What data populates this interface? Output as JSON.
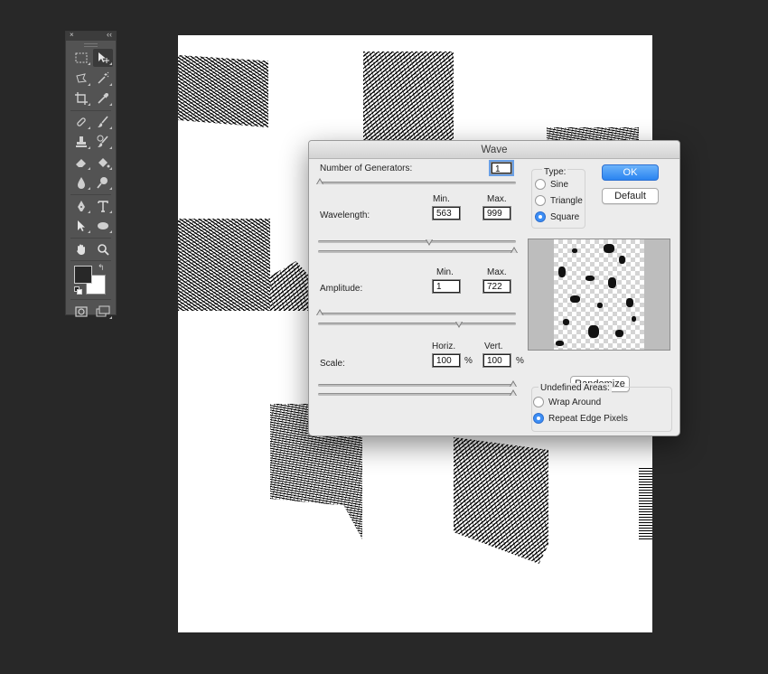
{
  "tools_panel": {
    "close_glyph": "×",
    "collapse_glyph": "‹‹",
    "tool_icons": [
      [
        "rect-marquee-icon",
        "move-icon"
      ],
      [
        "lasso-icon",
        "magic-wand-icon"
      ],
      [
        "crop-icon",
        "eyedropper-icon"
      ],
      [
        "healing-brush-icon",
        "brush-icon"
      ],
      [
        "clone-stamp-icon",
        "history-brush-icon"
      ],
      [
        "eraser-icon",
        "paint-bucket-icon"
      ],
      [
        "blur-icon",
        "dodge-icon"
      ],
      [
        "pen-icon",
        "type-icon"
      ],
      [
        "path-selection-icon",
        "ellipse-shape-icon"
      ],
      [
        "hand-icon",
        "zoom-icon"
      ]
    ],
    "swap_glyph": "↰",
    "foreground_color": "#282828",
    "background_color": "#ffffff"
  },
  "dialog": {
    "title": "Wave",
    "generators_label": "Number of Generators:",
    "generators_value": "1",
    "min_label": "Min.",
    "max_label": "Max.",
    "wavelength_label": "Wavelength:",
    "wavelength_min": "563",
    "wavelength_max": "999",
    "amplitude_label": "Amplitude:",
    "amplitude_min": "1",
    "amplitude_max": "722",
    "horiz_label": "Horiz.",
    "vert_label": "Vert.",
    "scale_label": "Scale:",
    "scale_horiz": "100",
    "scale_vert": "100",
    "percent": "%",
    "type_label": "Type:",
    "type_options": [
      "Sine",
      "Triangle",
      "Square"
    ],
    "type_selected": "Square",
    "ok_label": "OK",
    "default_label": "Default",
    "randomize_label": "Randomize",
    "undefined_label": "Undefined Areas:",
    "undefined_options": [
      "Wrap Around",
      "Repeat Edge Pixels"
    ],
    "undefined_selected": "Repeat Edge Pixels",
    "accent_color": "#2a84f0"
  }
}
